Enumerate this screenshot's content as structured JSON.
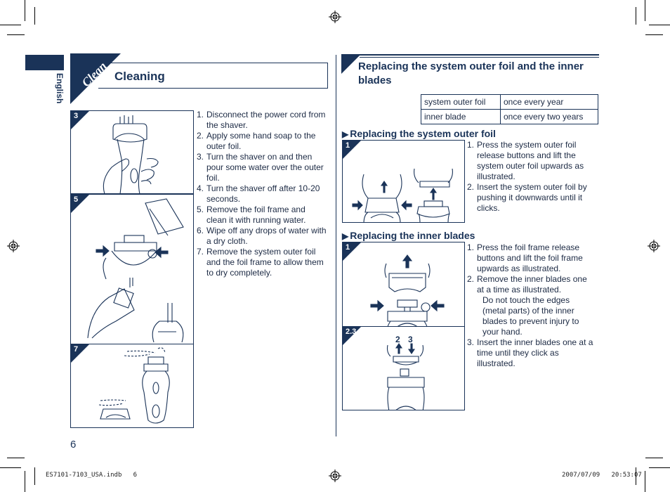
{
  "language_tab": {
    "label": "English"
  },
  "left_section": {
    "badge": "Clean",
    "title": "Cleaning",
    "panels": [
      {
        "step_label": "3",
        "illustration": "pour-water-over-foil"
      },
      {
        "step_label": "5",
        "illustration": "remove-and-rinse-foil-frame"
      },
      {
        "step_label": "7",
        "illustration": "dry-parts"
      }
    ],
    "steps": [
      {
        "n": "1.",
        "text": "Disconnect the power cord from the shaver."
      },
      {
        "n": "2.",
        "text": "Apply some hand soap to the outer foil."
      },
      {
        "n": "3.",
        "text": "Turn the shaver on and then pour some water over the outer foil."
      },
      {
        "n": "4.",
        "text": "Turn the shaver off after 10-20 seconds."
      },
      {
        "n": "5.",
        "text": "Remove the foil frame and clean it with running water."
      },
      {
        "n": "6.",
        "text": "Wipe off any drops of water with a dry cloth."
      },
      {
        "n": "7.",
        "text": "Remove the system outer foil and the foil frame to allow them to dry completely."
      }
    ]
  },
  "right_section": {
    "title": "Replacing the system outer foil and the inner blades",
    "interval_table": [
      {
        "part": "system outer foil",
        "interval": "once every year"
      },
      {
        "part": "inner blade",
        "interval": "once every two years"
      }
    ],
    "outer_foil": {
      "heading_icon": "triangle-right-icon",
      "heading": "Replacing the system outer foil",
      "panel_label": "1",
      "steps": [
        {
          "n": "1.",
          "text": "Press the system outer foil release buttons and lift the system outer foil upwards as illustrated."
        },
        {
          "n": "2.",
          "text": "Insert the system outer foil by pushing it downwards until it clicks."
        }
      ]
    },
    "inner_blades": {
      "heading_icon": "triangle-right-icon",
      "heading": "Replacing the inner blades",
      "panel_labels": [
        "1",
        "2.3"
      ],
      "arrow_labels": [
        "2",
        "3"
      ],
      "steps": [
        {
          "n": "1.",
          "text": "Press the foil frame release buttons and lift the foil frame upwards as illustrated."
        },
        {
          "n": "2.",
          "text": "Remove the inner blades one at a time as illustrated."
        },
        {
          "n": "",
          "text": "Do not touch the edges (metal parts) of the inner blades to prevent injury to your hand."
        },
        {
          "n": "3.",
          "text": "Insert the inner blades one at a time until they click as illustrated."
        }
      ]
    }
  },
  "page_number": "6",
  "footer": {
    "file": "ES7101-7103_USA.indb   6",
    "timestamp": "2007/07/09   20:53:07"
  },
  "colors": {
    "accent": "#1a3358"
  }
}
